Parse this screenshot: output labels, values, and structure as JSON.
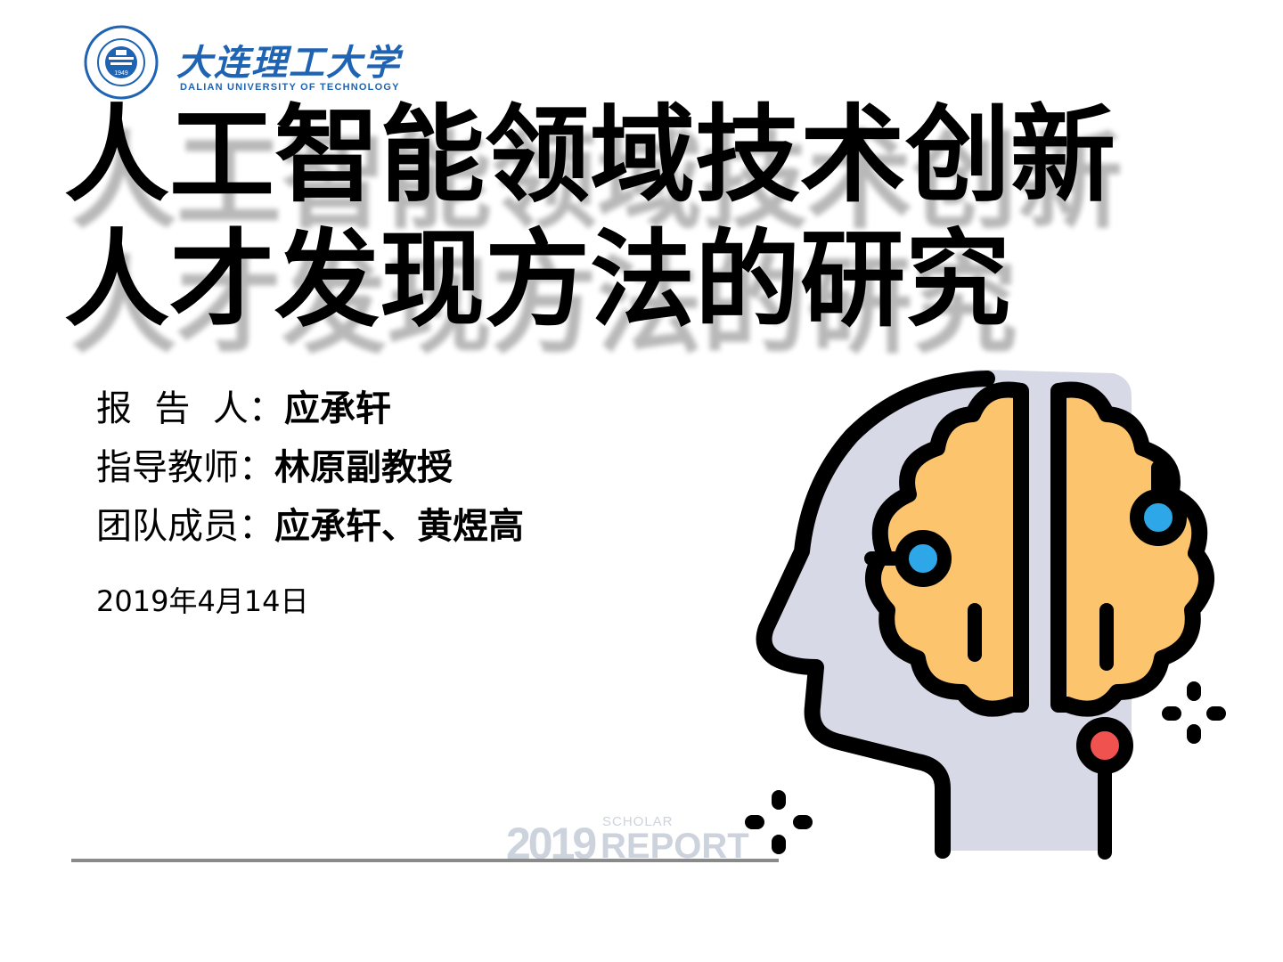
{
  "logo": {
    "name_cn": "大连理工大学",
    "name_en": "DALIAN UNIVERSITY OF TECHNOLOGY",
    "seal_year": "1949"
  },
  "title": {
    "line1": "人工智能领域技术创新",
    "line2": "人才发现方法的研究"
  },
  "info": {
    "reporter_label": "报  告  人：",
    "reporter": "应承轩",
    "advisor_label": "指导教师：",
    "advisor": "林原副教授",
    "team_label": "团队成员：",
    "team": "应承轩、黄煜高"
  },
  "date": "2019年4月14日",
  "footer": {
    "year": "2019",
    "scholar": "SCHOLAR",
    "report": "REPORT"
  },
  "colors": {
    "brand_blue": "#1f63b3",
    "brain_orange": "#fcc56d",
    "head_gray": "#d8d9e6",
    "node_blue": "#2da7e7",
    "node_red": "#f0524f"
  },
  "icons": [
    "university-seal-icon",
    "ai-head-brain-icon",
    "sparkle-icon"
  ]
}
